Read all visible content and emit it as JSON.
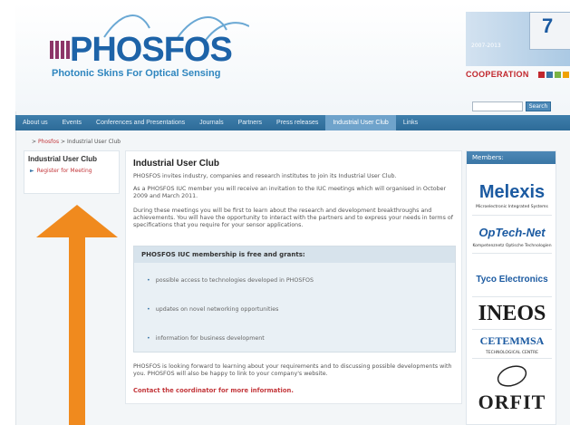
{
  "header": {
    "logo_text": "PHOSFOS",
    "tagline": "Photonic Skins For Optical Sensing",
    "fp7": {
      "number": "7",
      "years": "2007-2013",
      "label": "COOPERATION",
      "square_colors": [
        "#c1272d",
        "#3a76a5",
        "#7bb342",
        "#f0a202",
        "#8d3568"
      ]
    },
    "search": {
      "value": "",
      "button_label": "Search"
    }
  },
  "nav": {
    "items": [
      {
        "label": "About us",
        "active": false
      },
      {
        "label": "Events",
        "active": false
      },
      {
        "label": "Conferences and Presentations",
        "active": false
      },
      {
        "label": "Journals",
        "active": false
      },
      {
        "label": "Partners",
        "active": false
      },
      {
        "label": "Press releases",
        "active": false
      },
      {
        "label": "Industrial User Club",
        "active": true
      },
      {
        "label": "Links",
        "active": false
      }
    ]
  },
  "breadcrumb": {
    "prefix": ">",
    "home": "Phosfos",
    "separator": ">",
    "current": "Industrial User Club"
  },
  "sidebar": {
    "title": "Industrial User Club",
    "link": "Register for Meeting"
  },
  "main": {
    "title": "Industrial User Club",
    "p1": "PHOSFOS invites industry, companies and research institutes to join its Industrial User Club.",
    "p2": "As a PHOSFOS IUC member you will receive an invitation to the IUC meetings which will organised in October 2009 and March 2011.",
    "p3": "During these meetings you will be first to learn about the research and development breakthroughs and achievements. You will have the opportunity to interact with the partners and to express your needs in terms of specifications that you require for your sensor applications.",
    "benefits_title": "PHOSFOS IUC membership is free and grants:",
    "benefits": [
      "possible access to technologies developed in PHOSFOS",
      "updates on novel networking opportunities",
      "information for business development"
    ],
    "p4": "PHOSFOS is looking forward to learning about your requirements and to discussing possible developments with you. PHOSFOS will also be happy to link to your company's website.",
    "contact": "Contact the coordinator for more information."
  },
  "members": {
    "heading": "Members:",
    "logos": [
      {
        "name": "Melexis",
        "sub": "Microelectronic Integrated Systems",
        "color": "#1b5aa1"
      },
      {
        "name": "OpTech-Net",
        "sub": "Kompetenznetz Optische Technologien",
        "color": "#1b5aa1"
      },
      {
        "name": "Tyco Electronics",
        "sub": "",
        "color": "#1b5aa1"
      },
      {
        "name": "INEOS",
        "sub": "",
        "color": "#1a1a1a"
      },
      {
        "name": "CETEMMSA",
        "sub": "TECHNOLOGICAL CENTRE",
        "color": "#1b5aa1"
      },
      {
        "name": "ORFIT",
        "sub": "",
        "color": "#222222"
      }
    ]
  },
  "overlay": {
    "arrow_color": "#f08a1e"
  }
}
